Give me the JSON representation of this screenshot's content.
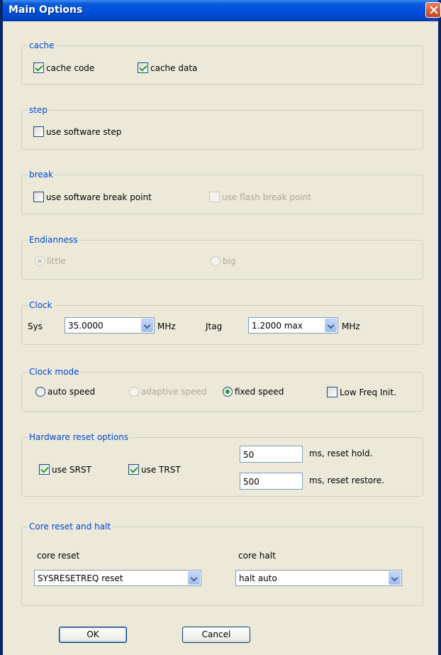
{
  "window": {
    "title": "Main Options"
  },
  "cache": {
    "legend": "cache",
    "cache_code": {
      "label": "cache code",
      "checked": true
    },
    "cache_data": {
      "label": "cache data",
      "checked": true
    }
  },
  "step": {
    "legend": "step",
    "use_software_step": {
      "label": "use software step",
      "checked": false
    }
  },
  "break": {
    "legend": "break",
    "use_software_break_point": {
      "label": "use software break point",
      "checked": false
    },
    "use_flash_break_point": {
      "label": "use flash break point",
      "checked": false,
      "disabled": true
    }
  },
  "endianness": {
    "legend": "Endianness",
    "little": {
      "label": "little",
      "selected": true,
      "disabled": true
    },
    "big": {
      "label": "big",
      "selected": false,
      "disabled": true
    }
  },
  "clock": {
    "legend": "Clock",
    "sys_label": "Sys",
    "sys_value": "35.0000",
    "sys_unit": "MHz",
    "jtag_label": "Jtag",
    "jtag_value": "1.2000 max",
    "jtag_unit": "MHz"
  },
  "clock_mode": {
    "legend": "Clock mode",
    "auto_speed": {
      "label": "auto speed",
      "selected": false
    },
    "adaptive_speed": {
      "label": "adaptive speed",
      "selected": false,
      "disabled": true
    },
    "fixed_speed": {
      "label": "fixed speed",
      "selected": true
    },
    "low_freq_init": {
      "label": "Low Freq Init.",
      "checked": false
    }
  },
  "hardware_reset": {
    "legend": "Hardware reset options",
    "use_srst": {
      "label": "use SRST",
      "checked": true
    },
    "use_trst": {
      "label": "use TRST",
      "checked": true
    },
    "reset_hold_value": "50",
    "reset_hold_label": "ms, reset hold.",
    "reset_restore_value": "500",
    "reset_restore_label": "ms, reset restore."
  },
  "core_reset_halt": {
    "legend": "Core reset and halt",
    "core_reset_label": "core reset",
    "core_reset_value": "SYSRESETREQ reset",
    "core_halt_label": "core halt",
    "core_halt_value": "halt auto"
  },
  "buttons": {
    "ok": "OK",
    "cancel": "Cancel"
  }
}
